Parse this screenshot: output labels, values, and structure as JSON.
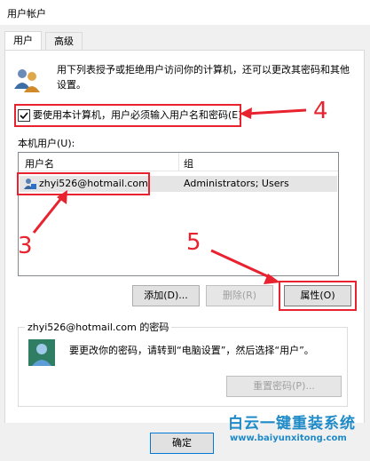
{
  "window": {
    "title": "用户帐户"
  },
  "tabs": [
    {
      "label": "用户"
    },
    {
      "label": "高级"
    }
  ],
  "intro_text": "用下列表授予或拒绝用户访问你的计算机，还可以更改其密码和其他设置。",
  "require_login": {
    "label": "要使用本计算机，用户必须输入用户名和密码(E)",
    "checked": true
  },
  "users_list": {
    "label": "本机用户(U):",
    "columns": [
      "用户名",
      "组"
    ],
    "rows": [
      {
        "username": "zhyi526@hotmail.com",
        "group": "Administrators; Users"
      }
    ]
  },
  "buttons": {
    "add": "添加(D)...",
    "remove": "删除(R)",
    "properties": "属性(O)"
  },
  "password_group": {
    "title": "zhyi526@hotmail.com 的密码",
    "text": "要更改你的密码，请转到“电脑设置”，然后选择“用户”。",
    "reset_button": "重置密码(P)..."
  },
  "footer": {
    "ok": "确定"
  },
  "annotations": {
    "a3": "3",
    "a4": "4",
    "a5": "5"
  },
  "watermark": {
    "title": "白云一键重装系统",
    "url": "www.baiyunxitong.com"
  },
  "colors": {
    "annotation_red": "#e8232f",
    "watermark_blue": "#1e8ac8",
    "selection": "#e5e5e5"
  }
}
